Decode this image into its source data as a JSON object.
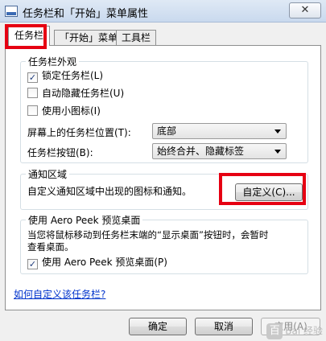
{
  "window": {
    "title": "任务栏和「开始」菜单属性",
    "close_glyph": "✕"
  },
  "tabs": [
    {
      "label": "任务栏",
      "active": true
    },
    {
      "label": "「开始」菜单",
      "active": false
    },
    {
      "label": "工具栏",
      "active": false
    }
  ],
  "appearance": {
    "legend": "任务栏外观",
    "lock_taskbar": {
      "label": "锁定任务栏(L)",
      "checked": true
    },
    "auto_hide": {
      "label": "自动隐藏任务栏(U)",
      "checked": false
    },
    "small_icons": {
      "label": "使用小图标(I)",
      "checked": false
    },
    "location_label": "屏幕上的任务栏位置(T):",
    "location_value": "底部",
    "buttons_label": "任务栏按钮(B):",
    "buttons_value": "始终合并、隐藏标签"
  },
  "notification": {
    "legend": "通知区域",
    "description": "自定义通知区域中出现的图标和通知。",
    "customize_button": "自定义(C)..."
  },
  "aero_peek": {
    "legend": "使用 Aero Peek 预览桌面",
    "description_line1": "当您将鼠标移动到任务栏末端的“显示桌面”按钮时，会暂时",
    "description_line2": "查看桌面。",
    "checkbox": {
      "label": "使用 Aero Peek 预览桌面(P)",
      "checked": true
    }
  },
  "help_link": "如何自定义该任务栏?",
  "buttons": {
    "ok": "确定",
    "cancel": "取消",
    "apply": "应用(A)"
  },
  "watermark": {
    "logo_glyph": "百",
    "text": "Bai 经验"
  },
  "colors": {
    "highlight": "#e60012",
    "link": "#0033cc"
  },
  "check_glyph": "✓"
}
